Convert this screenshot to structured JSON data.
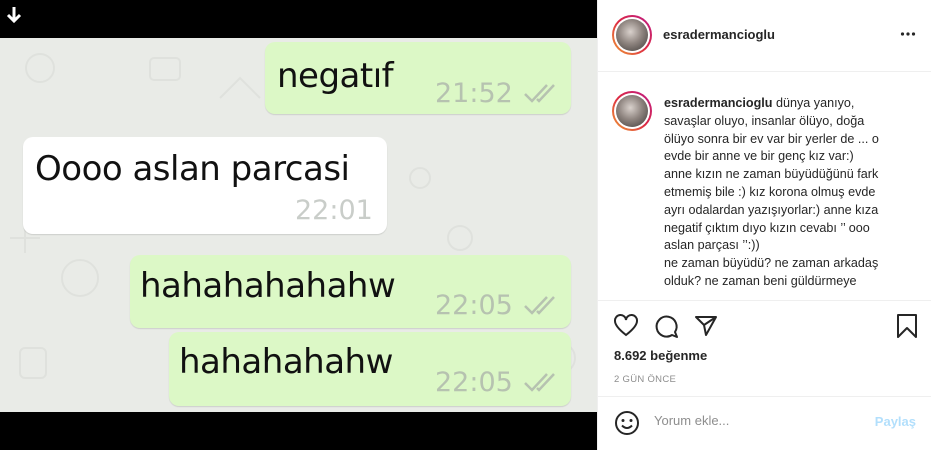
{
  "chat": {
    "messages": [
      {
        "direction": "out",
        "text": "negatıf",
        "time": "21:52",
        "read": true
      },
      {
        "direction": "in",
        "text": "Oooo aslan parcasi",
        "time": "22:01",
        "read": false
      },
      {
        "direction": "out",
        "text": "hahahahahahw",
        "time": "22:05",
        "read": true
      },
      {
        "direction": "out",
        "text": "hahahahahw",
        "time": "22:05",
        "read": true
      }
    ]
  },
  "post": {
    "username": "esradermancioglu",
    "caption_user": "esradermancioglu",
    "caption_lines": [
      "dünya yanıyo,",
      "savaşlar oluyo, insanlar ölüyo, doğa",
      "ölüyo sonra bir ev var bir yerler de ... o",
      "evde bir anne ve bir genç kız var:)",
      "anne kızın ne zaman büyüdüğünü fark",
      "etmemiş bile :) kız korona olmuş evde",
      "ayrı odalardan yazışıyorlar:) anne kıza",
      "negatif çıktım dıyo kızın cevabı ’’ ooo",
      "aslan parçası ’’:))",
      "ne zaman büyüdü? ne zaman arkadaş",
      "olduk? ne zaman beni güldürmeye"
    ],
    "likes": "8.692 beğenme",
    "time_ago": "2 GÜN ÖNCE",
    "comment_placeholder": "Yorum ekle...",
    "post_button": "Paylaş"
  },
  "icons": {
    "download": "download-arrow-icon",
    "more": "more-options-icon",
    "like": "heart-icon",
    "comment": "comment-icon",
    "share": "share-icon",
    "save": "bookmark-icon",
    "emoji": "emoji-icon"
  }
}
